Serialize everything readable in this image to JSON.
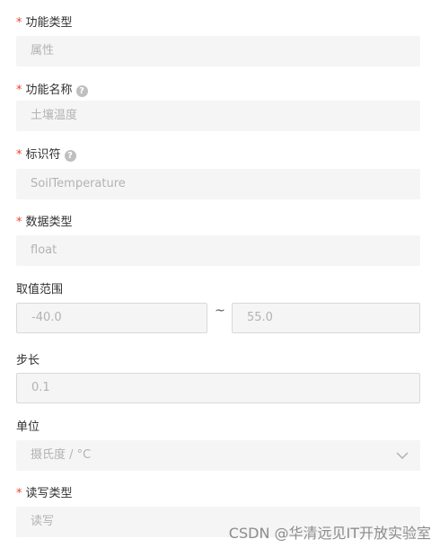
{
  "form": {
    "function_type": {
      "label": "功能类型",
      "value": "属性"
    },
    "function_name": {
      "label": "功能名称",
      "value": "土壤温度"
    },
    "identifier": {
      "label": "标识符",
      "value": "SoilTemperature"
    },
    "data_type": {
      "label": "数据类型",
      "value": "float"
    },
    "value_range": {
      "label": "取值范围",
      "min": "-40.0",
      "separator": "~",
      "max": "55.0"
    },
    "step": {
      "label": "步长",
      "value": "0.1"
    },
    "unit": {
      "label": "单位",
      "value": "摄氏度 / °C"
    },
    "rw_type": {
      "label": "读写类型",
      "value": "读写"
    }
  },
  "required_marker": "*",
  "help_glyph": "?",
  "watermark": "CSDN @华清远见IT开放实验室"
}
